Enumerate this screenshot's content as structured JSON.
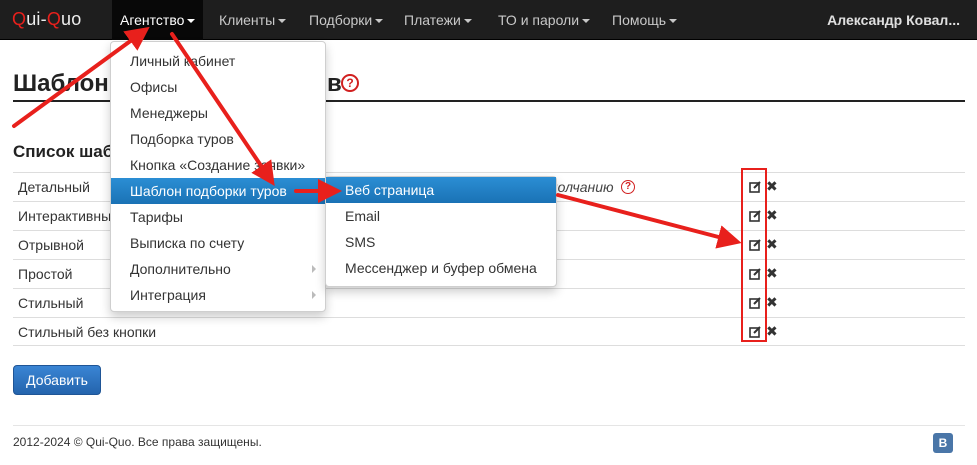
{
  "brand": {
    "part1": "Q",
    "part2": "ui-",
    "part3": "Q",
    "part4": "uo"
  },
  "nav": {
    "items": [
      "Агентство",
      "Клиенты",
      "Подборки",
      "Платежи",
      "ТО и пароли",
      "Помощь"
    ],
    "user": "Александр Ковал..."
  },
  "page": {
    "title_left": "Шаблон",
    "title_right": "в",
    "help": "?",
    "section_title": "Список шаб"
  },
  "templates": [
    {
      "name": "Детальный"
    },
    {
      "name": "Интерактивны"
    },
    {
      "name": "Отрывной"
    },
    {
      "name": "Простой"
    },
    {
      "name": "Стильный"
    },
    {
      "name": "Стильный без кнопки"
    }
  ],
  "default_note": "молчанию",
  "add_button": "Добавить",
  "footer": {
    "copyright": "2012-2024 © Qui-Quo. Все права защищены.",
    "vk": "B"
  },
  "agency_menu": [
    "Личный кабинет",
    "Офисы",
    "Менеджеры",
    "Подборка туров",
    "Кнопка «Создание заявки»",
    "Шаблон подборки туров",
    "Тарифы",
    "Выписка по счету",
    "Дополнительно",
    "Интеграция"
  ],
  "template_submenu": [
    "Веб страница",
    "Email",
    "SMS",
    "Мессенджер и буфер обмена"
  ],
  "colors": {
    "navbar": "#1e1e1e",
    "accent": "#e8201c",
    "menu_active": "#1f7fc4",
    "button": "#2a6ebb"
  }
}
